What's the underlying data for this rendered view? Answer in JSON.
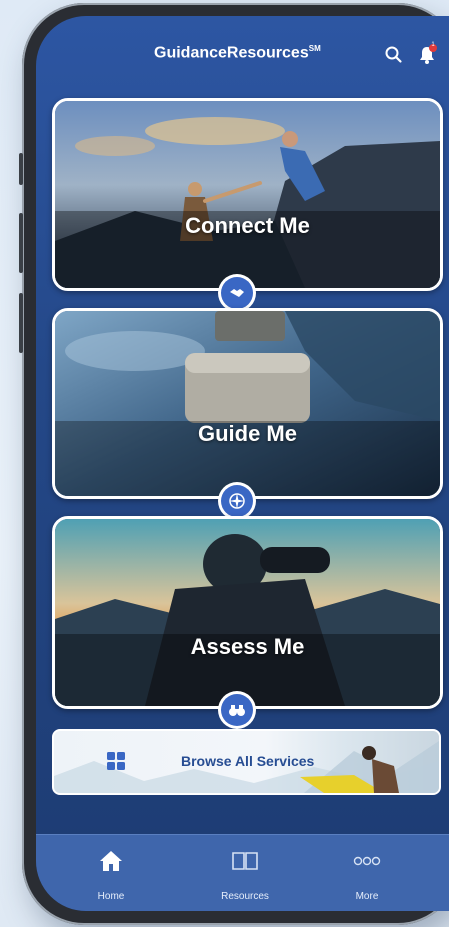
{
  "app": {
    "title": "GuidanceResources",
    "trademark": "SM",
    "notification_count": "1"
  },
  "header": {
    "search_icon": "search-icon",
    "bell_icon": "bell-icon"
  },
  "cards": [
    {
      "label": "Connect Me",
      "icon": "handshake-icon"
    },
    {
      "label": "Guide Me",
      "icon": "compass-icon"
    },
    {
      "label": "Assess Me",
      "icon": "binoculars-icon"
    }
  ],
  "browse": {
    "label": "Browse All Services",
    "icon": "grid-icon"
  },
  "tabs": [
    {
      "label": "Home",
      "icon": "home-icon"
    },
    {
      "label": "Resources",
      "icon": "book-icon"
    },
    {
      "label": "More",
      "icon": "more-icon"
    }
  ],
  "colors": {
    "screen_top": "#2d56a3",
    "screen_bottom": "#1d3b72",
    "accent": "#3a67c4",
    "tabbar": "#3f66ac",
    "notification": "#e03a3a"
  }
}
